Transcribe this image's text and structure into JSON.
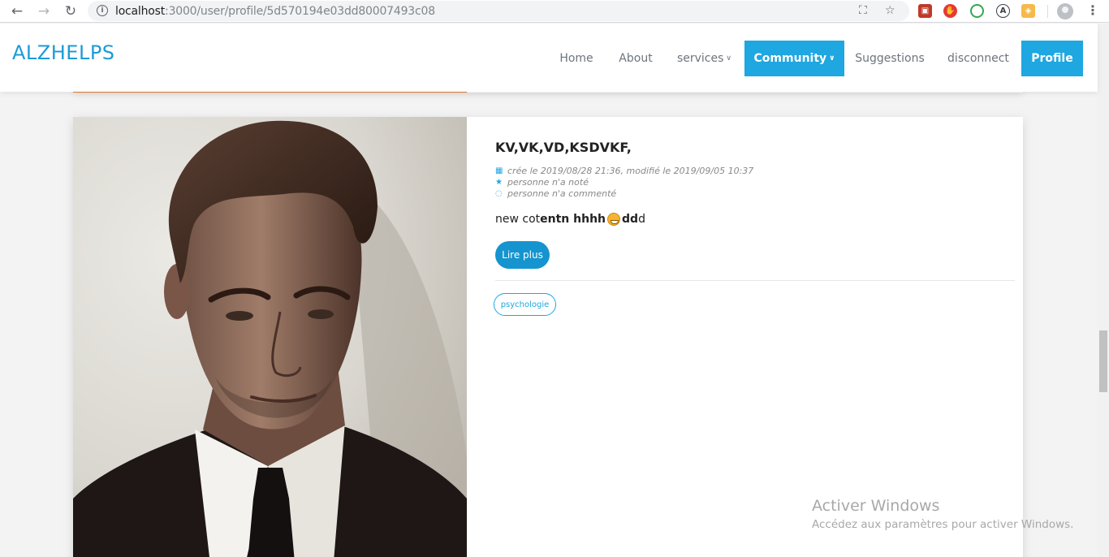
{
  "browser": {
    "url_host": "localhost",
    "url_rest": ":3000/user/profile/5d570194e03dd80007493c08",
    "icons": [
      "back-icon",
      "forward-icon",
      "reload-icon",
      "info-icon",
      "translate-icon",
      "star-icon",
      "extension-icon",
      "menu-icon"
    ]
  },
  "site": {
    "logo": "ALZHELPS",
    "nav": {
      "home": "Home",
      "about": "About",
      "services": "services",
      "community": "Community",
      "suggestions": "Suggestions",
      "disconnect": "disconnect",
      "profile": "Profile"
    },
    "accent_color": "#1ea7e0"
  },
  "post": {
    "title": "KV,VK,VD,KSDVKF,",
    "meta_dates": "crée le 2019/08/28 21:36, modifié le 2019/09/05 10:37",
    "meta_rating": "personne n'a noté",
    "meta_comments": "personne n'a commenté",
    "body_plain_1": "new cot",
    "body_bold_1": "entn hhhh ",
    "body_bold_2": "dd",
    "body_plain_2": "d",
    "read_more": "Lire plus",
    "tag": "psychologie"
  },
  "watermark": {
    "line1": "Activer Windows",
    "line2": "Accédez aux paramètres pour activer Windows."
  }
}
